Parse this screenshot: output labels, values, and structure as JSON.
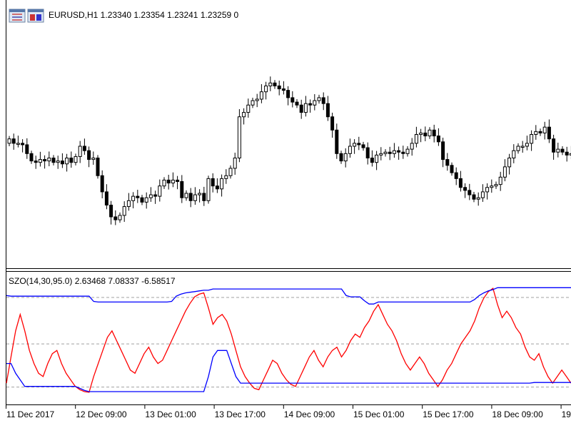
{
  "header": {
    "symbol_line": "EURUSD,H1  1.23340 1.23354 1.23241 1.23259  0",
    "icons": [
      "chart-window-icon",
      "chart-window-icon-2"
    ]
  },
  "indicator": {
    "title": "SZO(14,30,95.0) 2.63468 7.08337 -6.58517"
  },
  "colors": {
    "candle": "#000000",
    "szo_line": "#ff0000",
    "band_line": "#0000ff",
    "level_line": "#a0a0a0"
  },
  "chart_data": [
    {
      "type": "candlestick",
      "title": "EURUSD,H1  1.23340 1.23354 1.23241 1.23259  0",
      "x_tick_labels": [
        "11 Dec 2017",
        "12 Dec 09:00",
        "13 Dec 01:00",
        "13 Dec 17:00",
        "14 Dec 09:00",
        "15 Dec 01:00",
        "15 Dec 17:00",
        "18 Dec 09:00",
        "19"
      ],
      "ylim": [
        1.1715,
        1.1875
      ],
      "grid": false,
      "close_series": [
        1.18,
        1.1797,
        1.1797,
        1.1796,
        1.179,
        1.1785,
        1.1784,
        1.1786,
        1.1785,
        1.1787,
        1.1784,
        1.1785,
        1.1783,
        1.1787,
        1.1784,
        1.1788,
        1.1795,
        1.1792,
        1.1786,
        1.1787,
        1.1775,
        1.1764,
        1.1755,
        1.1747,
        1.1745,
        1.1748,
        1.1754,
        1.1758,
        1.1761,
        1.176,
        1.1757,
        1.176,
        1.1762,
        1.1761,
        1.1768,
        1.1772,
        1.177,
        1.1772,
        1.1771,
        1.176,
        1.1763,
        1.1758,
        1.1762,
        1.1763,
        1.1758,
        1.1773,
        1.1768,
        1.1766,
        1.1773,
        1.1775,
        1.178,
        1.1787,
        1.1815,
        1.1818,
        1.1823,
        1.1826,
        1.1827,
        1.1832,
        1.1836,
        1.1838,
        1.1836,
        1.1834,
        1.1833,
        1.1828,
        1.1825,
        1.1823,
        1.1818,
        1.1824,
        1.1823,
        1.1826,
        1.1828,
        1.1824,
        1.1815,
        1.1806,
        1.179,
        1.1785,
        1.179,
        1.1795,
        1.1797,
        1.1796,
        1.1794,
        1.1787,
        1.1784,
        1.1789,
        1.179,
        1.1791,
        1.179,
        1.1792,
        1.1791,
        1.179,
        1.1793,
        1.1797,
        1.1803,
        1.1804,
        1.1802,
        1.1806,
        1.1802,
        1.1798,
        1.1786,
        1.1782,
        1.1777,
        1.1773,
        1.1767,
        1.1765,
        1.1762,
        1.1759,
        1.176,
        1.1764,
        1.1767,
        1.1768,
        1.1769,
        1.1774,
        1.1781,
        1.1787,
        1.1792,
        1.1795,
        1.1795,
        1.1797,
        1.1803,
        1.1805,
        1.1804,
        1.1808,
        1.18,
        1.1791,
        1.1793,
        1.1791,
        1.1789,
        1.179
      ],
      "last_candle_ohlc": [
        1.2334,
        1.23354,
        1.23241,
        1.23259
      ]
    },
    {
      "type": "line",
      "title": "SZO(14,30,95.0) 2.63468 7.08337 -6.58517",
      "ylim": [
        -8.5,
        9.5
      ],
      "levels": [
        -6.6,
        0,
        7.1
      ],
      "series": [
        {
          "name": "",
          "color": "#ff0000",
          "values": [
            -6.0,
            -2.0,
            2.0,
            4.5,
            2.0,
            -1.0,
            -3.0,
            -4.5,
            -5.0,
            -3.0,
            -1.5,
            -1.0,
            -3.0,
            -4.5,
            -5.5,
            -6.5,
            -7.0,
            -7.3,
            -7.4,
            -5.0,
            -3.0,
            -1.0,
            1.0,
            2.0,
            0.5,
            -1.0,
            -2.5,
            -4.0,
            -4.5,
            -3.0,
            -1.5,
            -0.5,
            -2.0,
            -3.0,
            -2.5,
            -1.0,
            0.5,
            2.0,
            3.5,
            5.0,
            6.2,
            7.2,
            7.6,
            7.8,
            5.5,
            3.0,
            4.0,
            4.5,
            3.5,
            1.5,
            -1.0,
            -3.5,
            -5.0,
            -6.0,
            -6.8,
            -7.0,
            -5.5,
            -4.0,
            -2.5,
            -3.0,
            -4.5,
            -5.5,
            -6.2,
            -6.5,
            -5.0,
            -3.5,
            -2.0,
            -1.0,
            -2.5,
            -3.5,
            -2.0,
            -1.0,
            -0.5,
            -2.0,
            -1.0,
            0.5,
            1.5,
            1.0,
            2.5,
            3.5,
            5.0,
            6.0,
            4.5,
            3.0,
            2.0,
            0.5,
            -1.5,
            -3.0,
            -4.0,
            -3.0,
            -2.0,
            -3.0,
            -4.5,
            -5.5,
            -6.5,
            -5.5,
            -4.0,
            -3.0,
            -1.5,
            0.0,
            1.0,
            2.0,
            3.5,
            5.5,
            7.0,
            8.0,
            8.5,
            6.0,
            4.0,
            5.0,
            4.0,
            2.5,
            1.5,
            -0.5,
            -2.0,
            -2.5,
            -1.5,
            -3.5,
            -5.0,
            -6.0,
            -5.0,
            -4.0,
            -5.0,
            -6.0
          ]
        },
        {
          "name": "",
          "color": "#0000ff",
          "values": [
            7.4,
            7.3,
            7.3,
            7.3,
            7.3,
            7.3,
            7.3,
            7.3,
            7.3,
            7.3,
            7.3,
            7.3,
            7.3,
            7.3,
            7.3,
            7.3,
            7.3,
            7.3,
            7.3,
            6.5,
            6.4,
            6.4,
            6.4,
            6.4,
            6.4,
            6.4,
            6.4,
            6.4,
            6.4,
            6.4,
            6.4,
            6.4,
            6.4,
            6.4,
            6.4,
            6.4,
            6.5,
            7.3,
            7.6,
            7.8,
            7.9,
            8.0,
            8.1,
            8.2,
            8.2,
            8.4,
            8.4,
            8.4,
            8.4,
            8.4,
            8.4,
            8.4,
            8.4,
            8.4,
            8.4,
            8.4,
            8.4,
            8.4,
            8.4,
            8.4,
            8.4,
            8.4,
            8.4,
            8.4,
            8.4,
            8.4,
            8.4,
            8.4,
            8.4,
            8.4,
            8.4,
            8.4,
            8.4,
            8.4,
            7.4,
            7.2,
            7.2,
            7.2,
            6.6,
            6.1,
            6.1,
            6.4,
            6.4,
            6.4,
            6.4,
            6.4,
            6.4,
            6.4,
            6.4,
            6.4,
            6.4,
            6.4,
            6.4,
            6.4,
            6.4,
            6.4,
            6.4,
            6.4,
            6.4,
            6.4,
            6.4,
            6.4,
            6.8,
            7.4,
            7.8,
            8.1,
            8.3,
            8.6,
            8.6,
            8.6,
            8.6,
            8.6,
            8.6,
            8.6,
            8.6,
            8.6,
            8.6,
            8.6,
            8.6,
            8.6,
            8.6,
            8.6,
            8.6,
            8.6
          ]
        },
        {
          "name": "",
          "color": "#0000ff",
          "values": [
            -3.0,
            -3.0,
            -4.5,
            -5.5,
            -6.5,
            -6.5,
            -6.5,
            -6.5,
            -6.5,
            -6.5,
            -6.5,
            -6.5,
            -6.5,
            -6.5,
            -6.5,
            -6.5,
            -6.8,
            -7.1,
            -7.3,
            -7.3,
            -7.3,
            -7.3,
            -7.3,
            -7.3,
            -7.3,
            -7.3,
            -7.3,
            -7.3,
            -7.3,
            -7.3,
            -7.3,
            -7.3,
            -7.3,
            -7.3,
            -7.3,
            -7.3,
            -7.3,
            -7.3,
            -7.3,
            -7.3,
            -7.3,
            -7.3,
            -7.3,
            -7.3,
            -5.0,
            -2.0,
            -1.0,
            -1.0,
            -1.0,
            -3.0,
            -5.0,
            -6.0,
            -6.0,
            -6.0,
            -6.0,
            -6.0,
            -6.0,
            -6.0,
            -6.0,
            -6.0,
            -6.0,
            -6.0,
            -6.0,
            -6.0,
            -6.0,
            -6.0,
            -6.0,
            -6.0,
            -6.0,
            -6.0,
            -6.0,
            -6.0,
            -6.0,
            -6.0,
            -6.0,
            -6.0,
            -6.0,
            -6.0,
            -6.0,
            -6.0,
            -6.0,
            -6.0,
            -6.0,
            -6.0,
            -6.0,
            -6.0,
            -6.0,
            -6.0,
            -6.0,
            -6.0,
            -6.0,
            -6.0,
            -6.0,
            -6.0,
            -6.0,
            -6.0,
            -6.0,
            -6.0,
            -6.0,
            -6.0,
            -6.0,
            -6.0,
            -6.0,
            -6.0,
            -6.0,
            -6.0,
            -6.0,
            -6.0,
            -6.0,
            -6.0,
            -6.0,
            -6.0,
            -6.0,
            -6.0,
            -6.0,
            -5.9,
            -5.9,
            -5.9,
            -5.9,
            -5.9,
            -5.9,
            -5.9,
            -5.9,
            -5.9
          ]
        }
      ]
    }
  ]
}
